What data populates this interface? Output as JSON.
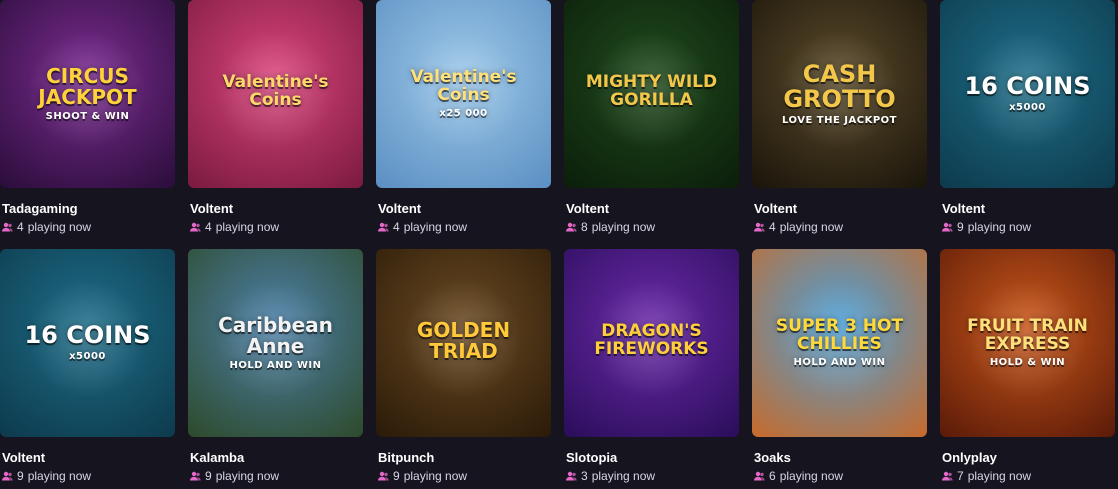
{
  "games": [
    {
      "thumb_title": "CIRCUS JACKPOT",
      "thumb_sub": "SHOOT & WIN",
      "provider": "Tadagaming",
      "players": "4",
      "bg": "#7a2b8f",
      "bg2": "#2a0d3a",
      "title_color": "#ffd23a"
    },
    {
      "thumb_title": "Valentine's Coins",
      "thumb_sub": "",
      "provider": "Voltent",
      "players": "4",
      "bg": "#d8447a",
      "bg2": "#7a1a3e",
      "title_color": "#ffd86a"
    },
    {
      "thumb_title": "Valentine's Coins",
      "thumb_sub": "x25 000",
      "provider": "Voltent",
      "players": "4",
      "bg": "#9cc7e8",
      "bg2": "#5b8fc2",
      "title_color": "#ffe07a"
    },
    {
      "thumb_title": "MIGHTY WILD GORILLA",
      "thumb_sub": "",
      "provider": "Voltent",
      "players": "8",
      "bg": "#1f4a1c",
      "bg2": "#0b1e0a",
      "title_color": "#f3c84a"
    },
    {
      "thumb_title": "CASH GROTTO",
      "thumb_sub": "LOVE THE JACKPOT",
      "provider": "Voltent",
      "players": "4",
      "bg": "#5a4a2a",
      "bg2": "#1a140a",
      "title_color": "#f3c84a"
    },
    {
      "thumb_title": "16 COINS",
      "thumb_sub": "x5000",
      "provider": "Voltent",
      "players": "9",
      "bg": "#1d6d88",
      "bg2": "#0d3a4c",
      "title_color": "#ffffff"
    },
    {
      "thumb_title": "16 COINS",
      "thumb_sub": "x5000",
      "provider": "Voltent",
      "players": "9",
      "bg": "#1d6d88",
      "bg2": "#0d3a4c",
      "title_color": "#ffffff"
    },
    {
      "thumb_title": "Caribbean Anne",
      "thumb_sub": "HOLD AND WIN",
      "provider": "Kalamba",
      "players": "9",
      "bg": "#4c7fa8",
      "bg2": "#2d4a2a",
      "title_color": "#f3f3f3"
    },
    {
      "thumb_title": "GOLDEN TRIAD",
      "thumb_sub": "",
      "provider": "Bitpunch",
      "players": "9",
      "bg": "#6a4a22",
      "bg2": "#2a1a08",
      "title_color": "#ffc93a"
    },
    {
      "thumb_title": "DRAGON'S FIREWORKS",
      "thumb_sub": "",
      "provider": "Slotopia",
      "players": "3",
      "bg": "#6a2aa8",
      "bg2": "#2a0d5a",
      "title_color": "#ffcf3a"
    },
    {
      "thumb_title": "SUPER 3 HOT CHILLIES",
      "thumb_sub": "HOLD AND WIN",
      "provider": "3oaks",
      "players": "6",
      "bg": "#4aa0d8",
      "bg2": "#c86a2a",
      "title_color": "#ffd93a"
    },
    {
      "thumb_title": "FRUIT TRAIN EXPRESS",
      "thumb_sub": "HOLD & WIN",
      "provider": "Onlyplay",
      "players": "7",
      "bg": "#c8561a",
      "bg2": "#5a1a08",
      "title_color": "#ffe07a"
    }
  ],
  "labels": {
    "playing_suffix": "playing now"
  },
  "colors": {
    "user_icon": "#e468c8",
    "background": "#16141f"
  }
}
